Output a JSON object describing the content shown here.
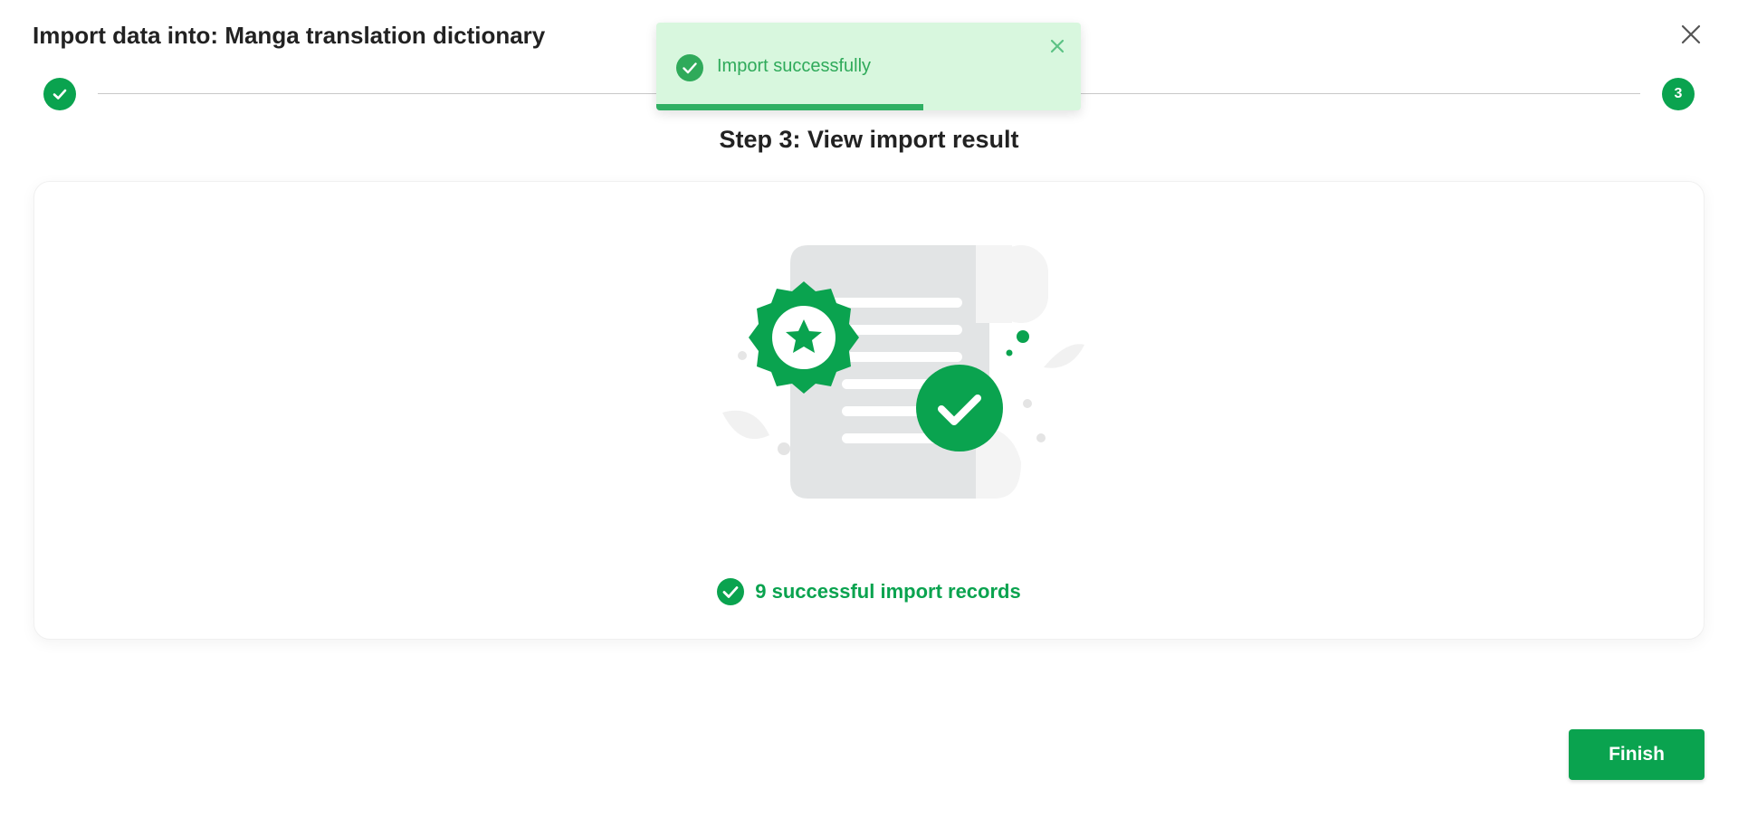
{
  "dialog": {
    "title": "Import data into: Manga translation dictionary"
  },
  "stepper": {
    "last_step_number": "3"
  },
  "step": {
    "heading": "Step 3: View import result"
  },
  "result": {
    "summary": "9 successful import records"
  },
  "footer": {
    "finish_label": "Finish"
  },
  "toast": {
    "message": "Import successfully",
    "progress_fraction": 0.63
  },
  "icons": {
    "close": "close-icon",
    "step_complete": "check-icon",
    "result_check": "check-circle-icon",
    "toast_check": "check-circle-icon",
    "toast_close": "close-icon"
  },
  "colors": {
    "accent": "#0aa34f",
    "toast_bg": "#d8f7de",
    "toast_text": "#2faa5a"
  }
}
